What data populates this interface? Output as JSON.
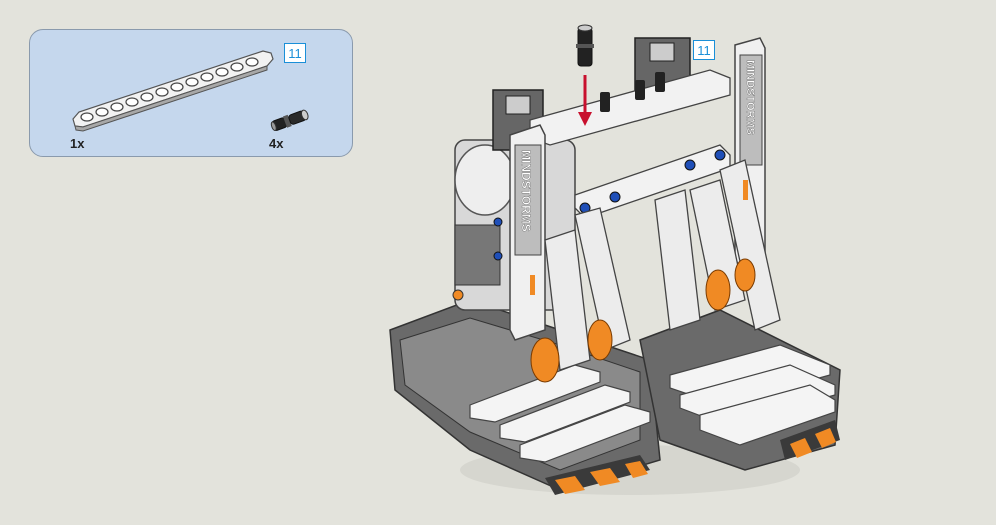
{
  "step_number_panel": "11",
  "step_number_model": "11",
  "parts": [
    {
      "name": "beam",
      "qty": "1x"
    },
    {
      "name": "connector-peg",
      "qty": "4x"
    }
  ],
  "model_text_1": "MINDSTORMS",
  "model_text_2": "MINDSTORMS",
  "colors": {
    "background": "#e3e3dc",
    "panel": "#c5d7ed",
    "badge_border": "#1a8fd8",
    "arrow": "#c8102e",
    "accent_orange": "#f08a24",
    "pin_blue": "#1f4fb8"
  }
}
